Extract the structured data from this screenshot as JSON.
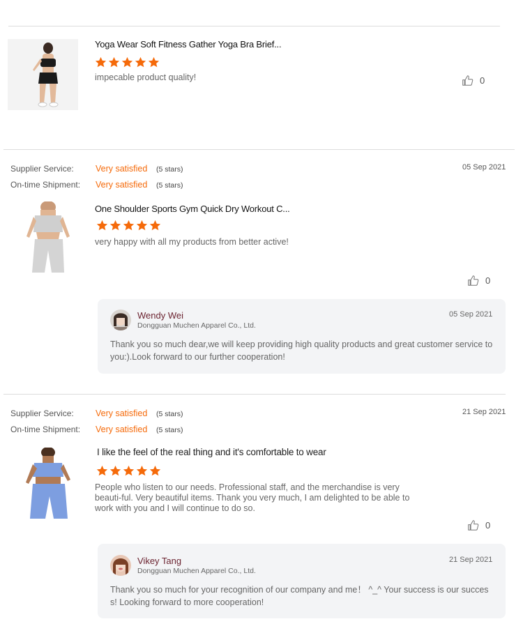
{
  "colors": {
    "star": "#f56a0a",
    "accent": "#f56a0a",
    "reply_bg": "#f3f4f6",
    "reply_name": "#6b2330"
  },
  "review1": {
    "product_title": "Yoga Wear Soft Fitness Gather Yoga Bra Brief...",
    "rating": 5,
    "text": "impecable product quality!",
    "likes": "0"
  },
  "review2": {
    "supplier_label": "Supplier Service:",
    "supplier_value": "Very satisfied",
    "supplier_count": "(5 stars)",
    "shipment_label": "On-time Shipment:",
    "shipment_value": "Very satisfied",
    "shipment_count": "(5 stars)",
    "date": "05 Sep 2021",
    "product_title": "One Shoulder Sports Gym Quick Dry Workout C...",
    "rating": 5,
    "text": "very happy with all my products from better active!",
    "likes": "0",
    "reply": {
      "name": "Wendy Wei",
      "company": "Dongguan Muchen Apparel Co., Ltd.",
      "date": "05 Sep 2021",
      "text": "Thank you so much dear,we will keep providing high quality products and great customer service to you:).Look forward to our further cooperation!"
    }
  },
  "review3": {
    "supplier_label": "Supplier Service:",
    "supplier_value": "Very satisfied",
    "supplier_count": "(5 stars)",
    "shipment_label": "On-time Shipment:",
    "shipment_value": "Very satisfied",
    "shipment_count": "(5 stars)",
    "date": "21 Sep 2021",
    "product_title": "I like the feel of the real thing and it's comfortable to wear",
    "rating": 5,
    "text": "People who listen to our needs. Professional staff, and the merchandise is very beauti-ful. Very beautiful items. Thank you very much, I am delighted to be able to work with you and I will continue to do so.",
    "likes": "0",
    "reply": {
      "name": "Vikey Tang",
      "company": "Dongguan Muchen Apparel Co., Ltd.",
      "date": "21 Sep 2021",
      "text": "Thank you so much for your recognition of our company and me！ ^_^ Your success is our success! Looking forward to more cooperation!"
    }
  }
}
